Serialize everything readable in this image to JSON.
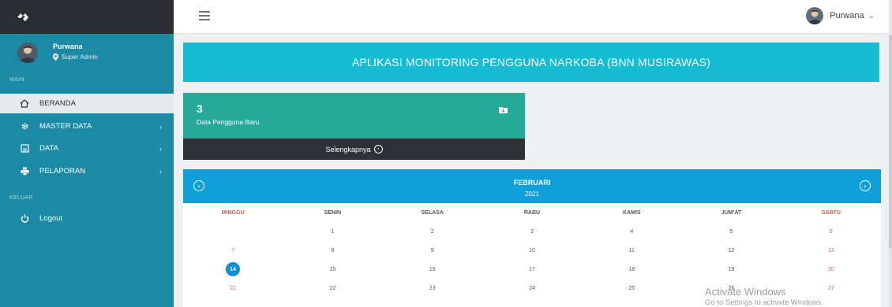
{
  "brand": {
    "logo_icon": "bnn-logo-icon"
  },
  "topbar": {
    "menu_icon": "hamburger-icon",
    "user_name": "Purwana",
    "chevron": "⌄"
  },
  "sidebar": {
    "profile": {
      "name": "Purwana",
      "role": "Super Admin"
    },
    "section_main": "MAIN",
    "section_keluar": "KELUAR",
    "items": [
      {
        "label": "BERANDA",
        "icon": "home-icon",
        "active": true
      },
      {
        "label": "MASTER DATA",
        "icon": "gear-icon",
        "arrow": "›"
      },
      {
        "label": "DATA",
        "icon": "file-icon",
        "arrow": "›"
      },
      {
        "label": "PELAPORAN",
        "icon": "printer-icon",
        "arrow": "›"
      }
    ],
    "logout": {
      "label": "Logout",
      "icon": "power-icon"
    }
  },
  "banner": {
    "title": "APLIKASI MONITORING PENGGUNA NARKOBA (BNN MUSIRAWAS)"
  },
  "info_box": {
    "count": "3",
    "label": "Data Pengguna Baru",
    "more": "Selengkapnya",
    "more_icon": "›"
  },
  "calendar": {
    "month": "FEBRUARI",
    "year": "2021",
    "prev_icon": "‹",
    "next_icon": "›",
    "days_of_week": [
      "MINGGU",
      "SENIN",
      "SELASA",
      "RABU",
      "KAMIS",
      "JUM'AT",
      "SABTU"
    ],
    "rows": [
      [
        "",
        "1",
        "2",
        "3",
        "4",
        "5",
        "6"
      ],
      [
        "7",
        "8",
        "9",
        "10",
        "11",
        "12",
        "13"
      ],
      [
        "14",
        "15",
        "16",
        "17",
        "18",
        "19",
        "20"
      ],
      [
        "21",
        "22",
        "23",
        "24",
        "25",
        "26",
        "27"
      ]
    ],
    "today": "14",
    "weekend_color": "#e05a4e"
  },
  "watermark": {
    "title": "Activate Windows",
    "subtitle": "Go to Settings to activate Windows."
  },
  "colors": {
    "sidebar": "#1b8aa4",
    "banner": "#15bcd3",
    "info_box": "#27a99a",
    "calendar_header": "#0f9fd9",
    "brand_bar": "#2b2f33"
  }
}
